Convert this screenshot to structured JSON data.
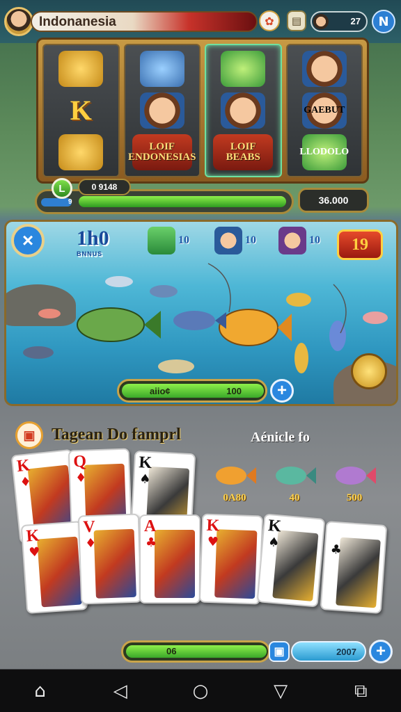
{
  "header": {
    "title": "Indonanesia",
    "profile_value": "27",
    "n_label": "N"
  },
  "slot": {
    "reels": [
      {
        "symbols": [
          {
            "type": "gold",
            "label": ""
          },
          {
            "type": "k",
            "label": "K"
          },
          {
            "type": "gold",
            "label": ""
          }
        ]
      },
      {
        "symbols": [
          {
            "type": "fish",
            "label": ""
          },
          {
            "type": "face",
            "label": ""
          },
          {
            "type": "text",
            "label": "LOIF ENDONESIAS"
          }
        ]
      },
      {
        "symbols": [
          {
            "type": "greenfish",
            "label": ""
          },
          {
            "type": "face",
            "label": ""
          },
          {
            "type": "text",
            "label": "LOIF BEABS"
          }
        ]
      },
      {
        "symbols": [
          {
            "type": "face",
            "label": ""
          },
          {
            "type": "face",
            "label": "GAEBUT"
          },
          {
            "type": "greenfish",
            "label": "LLODOLO"
          }
        ]
      }
    ],
    "level_badge": "L",
    "level_value": "0 9148",
    "status_small": "9",
    "balance": "36.000"
  },
  "fishing": {
    "close_label": "×",
    "big_bonus": "1h0",
    "big_bonus_sub": "BNNUS",
    "bonuses": [
      "10",
      "10",
      "10"
    ],
    "red_badge": "19",
    "catch_left": "aiio¢",
    "catch_right": "100",
    "plus_label": "+"
  },
  "cards_section": {
    "title": "Tagean Do famprl",
    "fish_title": "Aénicle fo",
    "fish_values": [
      "0A80",
      "40",
      "500"
    ],
    "cards_top": [
      {
        "rank": "K",
        "suit": "♦",
        "color": "red"
      },
      {
        "rank": "Q",
        "suit": "♦",
        "color": "red"
      },
      {
        "rank": "K",
        "suit": "♠",
        "color": "black"
      }
    ],
    "cards_bottom": [
      {
        "rank": "K",
        "suit": "♥",
        "color": "red"
      },
      {
        "rank": "V",
        "suit": "♦",
        "color": "red"
      },
      {
        "rank": "A",
        "suit": "♣",
        "color": "red"
      },
      {
        "rank": "K",
        "suit": "♥",
        "color": "red"
      },
      {
        "rank": "K",
        "suit": "♠",
        "color": "black"
      },
      {
        "rank": "",
        "suit": "♣",
        "color": "black"
      }
    ],
    "bottom_bar_value": "06",
    "save_icon_label": "▣",
    "score_value": "2007",
    "plus_label": "+"
  },
  "colors": {
    "accent_blue": "#2a87df",
    "progress_green": "#3aa82a",
    "frame_gold": "#c9a44a"
  },
  "icons": [
    "home-icon",
    "back-icon",
    "circle-home-icon",
    "recents-icon",
    "edit-icon"
  ]
}
